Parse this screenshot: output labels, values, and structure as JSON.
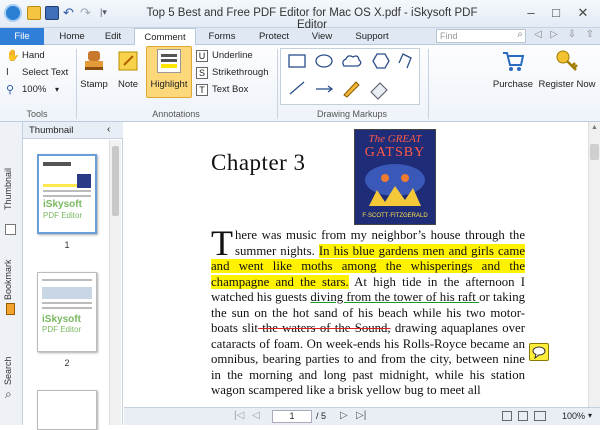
{
  "window": {
    "title": "Top 5 Best and Free PDF Editor for Mac OS X.pdf - iSkysoft PDF Editor"
  },
  "menu": {
    "file": "File",
    "home": "Home",
    "edit": "Edit",
    "comment": "Comment",
    "forms": "Forms",
    "protect": "Protect",
    "view": "View",
    "support": "Support"
  },
  "find": {
    "placeholder": "Find"
  },
  "tools": {
    "hand": "Hand",
    "select_text": "Select Text",
    "zoom": "100%",
    "group": "Tools"
  },
  "annotations": {
    "stamp": "Stamp",
    "note": "Note",
    "highlight": "Highlight",
    "underline": "Underline",
    "strikethrough": "Strikethrough",
    "text_box": "Text Box",
    "group": "Annotations"
  },
  "markups": {
    "group": "Drawing Markups"
  },
  "account": {
    "purchase": "Purchase",
    "register": "Register Now"
  },
  "sidebar": {
    "thumbnail_header": "Thumbnail",
    "tab_thumbnail": "Thumbnail",
    "tab_bookmark": "Bookmark",
    "tab_search": "Search",
    "pages": [
      "1",
      "2"
    ],
    "watermark_l1": "iSkysoft",
    "watermark_l2": "PDF Editor"
  },
  "document": {
    "chapter": "Chapter 3",
    "cover_title_1": "The GREAT",
    "cover_title_2": "GATSBY",
    "cover_author": "F·SCOTT·FITZGERALD",
    "p_dropcap": "T",
    "p_a": "here was music from my neighbor’s house through the summer nights. ",
    "p_hl": "In his blue gardens men and girls came and went like moths among the whisperings and the champagne and the stars.",
    "p_b": " At high tide in the afternoon I watched his guests ",
    "p_ul": "diving from the tower of his raft ",
    "p_c": "or taking the sun on the hot sand of his beach while his two motor-boats slit",
    "p_st": " the waters of the Sound,",
    "p_d": " drawing aquaplanes over cataracts of foam. On week-ends his Rolls-Royce became an omnibus, bearing parties to and from the city, between nine in the morning and long past midnight, while his station wagon scampered like a brisk yellow bug to meet all"
  },
  "status": {
    "page": "1",
    "of": "/ 5",
    "zoom": "100%"
  },
  "colors": {
    "accent": "#2f7ed8",
    "highlight": "#fff200",
    "underline": "#1a9a2a",
    "strike": "#d22222"
  }
}
